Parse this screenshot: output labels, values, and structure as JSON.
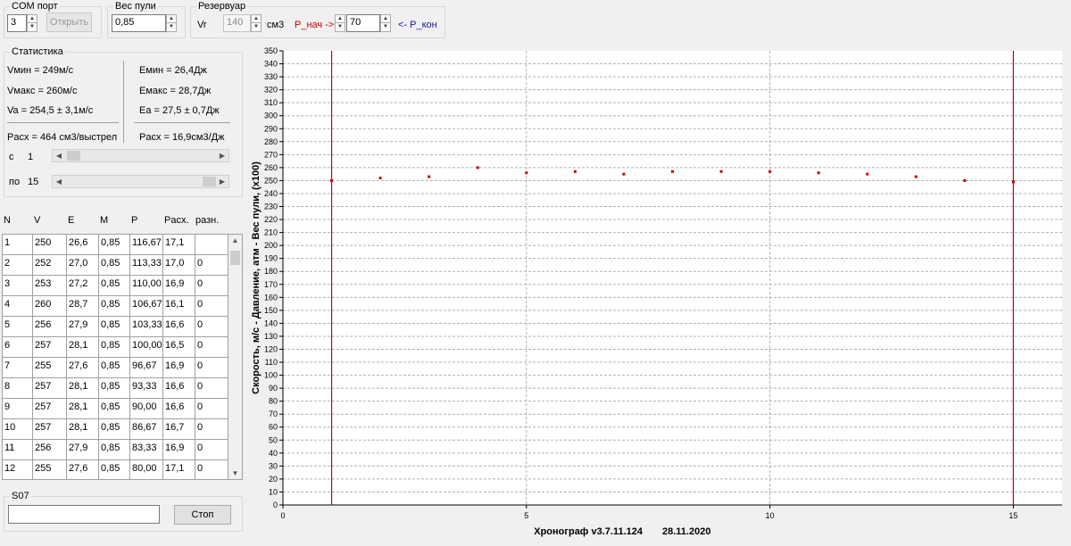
{
  "com_port": {
    "title": "COM порт",
    "value": "3",
    "open_label": "Открыть"
  },
  "bullet_weight": {
    "title": "Вес пули",
    "value": "0,85"
  },
  "reservoir": {
    "title": "Резервуар",
    "vr_label": "Vr",
    "vr_value": "140",
    "vr_unit": "см3",
    "p_start_label": "P_нач ->",
    "p_value": "70",
    "p_end_label": "<- P_кон"
  },
  "statistics": {
    "title": "Статистика",
    "vmin": "Vмин = 249м/с",
    "vmax": "Vмакс = 260м/с",
    "va": "Va = 254,5 ± 3,1м/с",
    "emin": "Eмин = 26,4Дж",
    "emax": "Eмакс = 28,7Дж",
    "ea": "Ea = 27,5 ± 0,7Дж",
    "flow_shot": "Pacx = 464 см3/выстрел",
    "flow_j": "Pacx = 16,9см3/Дж",
    "from_label": "с",
    "from_value": "1",
    "to_label": "по",
    "to_value": "15"
  },
  "table": {
    "headers": [
      "N",
      "V",
      "E",
      "M",
      "P",
      "Pacx.",
      "разн."
    ],
    "rows": [
      [
        "1",
        "250",
        "26,6",
        "0,85",
        "116,67",
        "17,1",
        ""
      ],
      [
        "2",
        "252",
        "27,0",
        "0,85",
        "113,33",
        "17,0",
        "0"
      ],
      [
        "3",
        "253",
        "27,2",
        "0,85",
        "110,00",
        "16,9",
        "0"
      ],
      [
        "4",
        "260",
        "28,7",
        "0,85",
        "106,67",
        "16,1",
        "0"
      ],
      [
        "5",
        "256",
        "27,9",
        "0,85",
        "103,33",
        "16,6",
        "0"
      ],
      [
        "6",
        "257",
        "28,1",
        "0,85",
        "100,00",
        "16,5",
        "0"
      ],
      [
        "7",
        "255",
        "27,6",
        "0,85",
        "96,67",
        "16,9",
        "0"
      ],
      [
        "8",
        "257",
        "28,1",
        "0,85",
        "93,33",
        "16,6",
        "0"
      ],
      [
        "9",
        "257",
        "28,1",
        "0,85",
        "90,00",
        "16,6",
        "0"
      ],
      [
        "10",
        "257",
        "28,1",
        "0,85",
        "86,67",
        "16,7",
        "0"
      ],
      [
        "11",
        "256",
        "27,9",
        "0,85",
        "83,33",
        "16,9",
        "0"
      ],
      [
        "12",
        "255",
        "27,6",
        "0,85",
        "80,00",
        "17,1",
        "0"
      ]
    ]
  },
  "s07": {
    "title": "S07",
    "value": "",
    "stop_label": "Стоп"
  },
  "chart_data": {
    "type": "scatter",
    "title": "Хронограф v3.7.11.124",
    "date": "28.11.2020",
    "ylabel": "Скорость, м/с  - Давление, атм - Вес пули, (x100)",
    "xlim": [
      0,
      16
    ],
    "ylim": [
      0,
      350
    ],
    "x_ticks": [
      0,
      5,
      10,
      15
    ],
    "y_step": 10,
    "markers_x": [
      1,
      15
    ],
    "points": [
      {
        "x": 1,
        "y": 250
      },
      {
        "x": 2,
        "y": 252
      },
      {
        "x": 3,
        "y": 253
      },
      {
        "x": 4,
        "y": 260
      },
      {
        "x": 5,
        "y": 256
      },
      {
        "x": 6,
        "y": 257
      },
      {
        "x": 7,
        "y": 255
      },
      {
        "x": 8,
        "y": 257
      },
      {
        "x": 9,
        "y": 257
      },
      {
        "x": 10,
        "y": 257
      },
      {
        "x": 11,
        "y": 256
      },
      {
        "x": 12,
        "y": 255
      },
      {
        "x": 13,
        "y": 253
      },
      {
        "x": 14,
        "y": 250
      },
      {
        "x": 15,
        "y": 249
      }
    ],
    "point_color": "#cc0000",
    "marker_color": "#cc0000",
    "grid": true
  }
}
